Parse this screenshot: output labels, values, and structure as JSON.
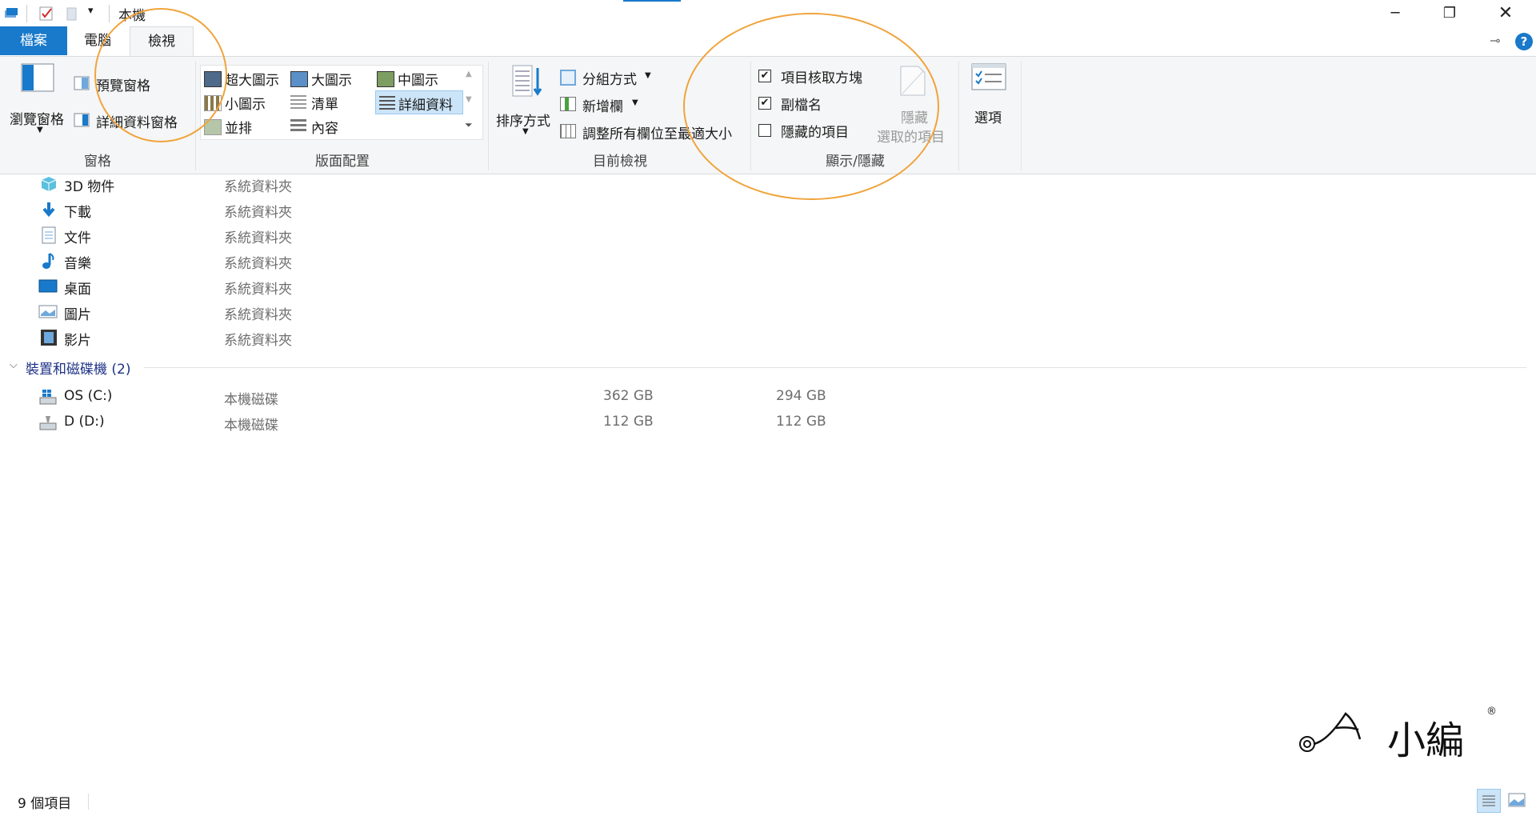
{
  "window": {
    "title": "本機"
  },
  "tabs": {
    "file": "檔案",
    "computer": "電腦",
    "view": "檢視"
  },
  "ribbon": {
    "panes": {
      "navigation_pane": "瀏覽窗格",
      "preview_pane": "預覽窗格",
      "details_pane": "詳細資料窗格",
      "group_label": "窗格"
    },
    "layout": {
      "extra_large_icons": "超大圖示",
      "large_icons": "大圖示",
      "medium_icons": "中圖示",
      "small_icons": "小圖示",
      "list": "清單",
      "details": "詳細資料",
      "tiles": "並排",
      "content": "內容",
      "group_label": "版面配置"
    },
    "current_view": {
      "sort_by": "排序方式",
      "group_by": "分組方式",
      "add_columns": "新增欄",
      "size_columns": "調整所有欄位至最適大小",
      "group_label": "目前檢視"
    },
    "show_hide": {
      "item_checkboxes": "項目核取方塊",
      "item_checkboxes_checked": true,
      "file_extensions": "副檔名",
      "file_extensions_checked": true,
      "hidden_items": "隱藏的項目",
      "hidden_items_checked": false,
      "hide_selected_1": "隱藏",
      "hide_selected_2": "選取的項目",
      "group_label": "顯示/隱藏"
    },
    "options": "選項"
  },
  "folders": [
    {
      "name": "3D 物件",
      "type": "系統資料夾",
      "icon": "cube-icon"
    },
    {
      "name": "下載",
      "type": "系統資料夾",
      "icon": "download-arrow-icon"
    },
    {
      "name": "文件",
      "type": "系統資料夾",
      "icon": "document-icon"
    },
    {
      "name": "音樂",
      "type": "系統資料夾",
      "icon": "music-note-icon"
    },
    {
      "name": "桌面",
      "type": "系統資料夾",
      "icon": "desktop-icon"
    },
    {
      "name": "圖片",
      "type": "系統資料夾",
      "icon": "pictures-icon"
    },
    {
      "name": "影片",
      "type": "系統資料夾",
      "icon": "film-icon"
    }
  ],
  "devices_group": {
    "label": "裝置和磁碟機 (2)"
  },
  "drives": [
    {
      "name": "OS (C:)",
      "type": "本機磁碟",
      "total": "362 GB",
      "free": "294 GB"
    },
    {
      "name": "D (D:)",
      "type": "本機磁碟",
      "total": "112 GB",
      "free": "112 GB"
    }
  ],
  "status": {
    "item_count": "9 個項目"
  },
  "watermark": {
    "text": "小編"
  },
  "colors": {
    "accent": "#1979ca",
    "annotation": "#f0a43c",
    "ribbon_bg": "#f5f6f7"
  }
}
